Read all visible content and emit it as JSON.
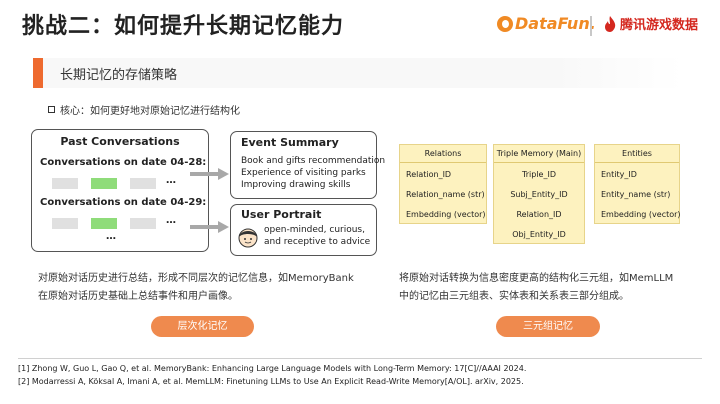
{
  "header": {
    "title": "挑战二：如何提升长期记忆能力",
    "logo_datafun": "DataFun.",
    "logo_tencent": "腾讯游戏数据"
  },
  "section": {
    "title": "长期记忆的存储策略"
  },
  "core": {
    "text": "核心：如何更好地对原始记忆进行结构化"
  },
  "memorybank": {
    "past_title": "Past Conversations",
    "date1": "Conversations on date 04-28:",
    "date2": "Conversations on date 04-29:",
    "dots": "…",
    "event_title": "Event Summary",
    "event_lines": [
      "Book and gifts recommendation",
      "Experience of visiting parks",
      "Improving drawing skills"
    ],
    "user_title": "User Portrait",
    "user_lines": [
      "open-minded, curious,",
      "and receptive to advice"
    ],
    "desc_line1": "对原始对话历史进行总结，形成不同层次的记忆信息，如MemoryBank",
    "desc_line2": "在原始对话历史基础上总结事件和用户画像。",
    "button": "层次化记忆"
  },
  "memllm": {
    "relations": {
      "header": "Relations",
      "rows": [
        "Relation_ID",
        "Relation_name (str)",
        "Embedding (vector)"
      ]
    },
    "triple": {
      "header": "Triple Memory (Main)",
      "rows": [
        "Triple_ID",
        "Subj_Entity_ID",
        "Relation_ID",
        "Obj_Entity_ID"
      ]
    },
    "entities": {
      "header": "Entities",
      "rows": [
        "Entity_ID",
        "Entity_name (str)",
        "Embedding (vector)"
      ]
    },
    "desc_line1": "将原始对话转换为信息密度更高的结构化三元组，如MemLLM",
    "desc_line2": "中的记忆由三元组表、实体表和关系表三部分组成。",
    "button": "三元组记忆"
  },
  "references": [
    "[1] Zhong W, Guo L, Gao Q, et al. MemoryBank: Enhancing Large Language Models with Long-Term Memory: 17[C]//AAAI 2024.",
    "[2] Modarressi A, Köksal A, Imani A, et al. MemLLM: Finetuning LLMs to Use An Explicit Read-Write Memory[A/OL]. arXiv, 2025."
  ],
  "colors": {
    "accent": "#ee6a2f",
    "button": "#ef8a4e",
    "table_fill": "#fdf2bf",
    "highlight_cell": "#8fdc7a"
  }
}
